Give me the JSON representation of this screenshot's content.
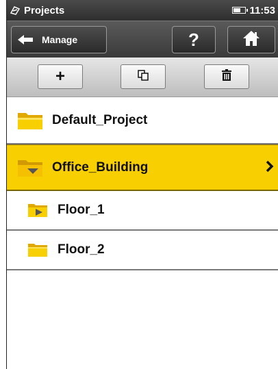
{
  "statusbar": {
    "app_title": "Projects",
    "time": "11:53",
    "battery_level": 0.5
  },
  "navbar": {
    "back_label": "Manage",
    "help_label": "?"
  },
  "toolbar": {
    "add_label": "+"
  },
  "list": {
    "items": [
      {
        "label": "Default_Project",
        "kind": "folder",
        "selected": false
      },
      {
        "label": "Office_Building",
        "kind": "folder-open",
        "selected": true
      },
      {
        "label": "Floor_1",
        "kind": "folder-play",
        "selected": false
      },
      {
        "label": "Floor_2",
        "kind": "folder",
        "selected": false
      }
    ]
  },
  "colors": {
    "selected_row": "#f8cf00",
    "folder": "#f5c400",
    "header_dark": "#3a3a3a"
  }
}
